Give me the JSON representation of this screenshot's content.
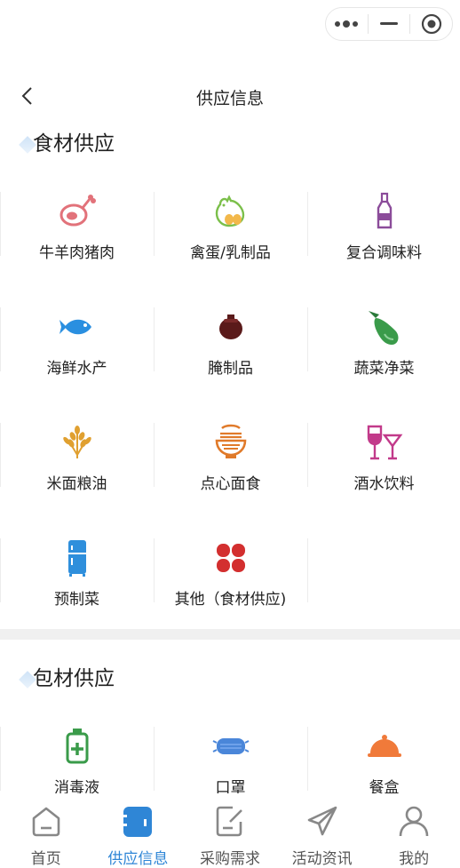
{
  "header": {
    "title": "供应信息"
  },
  "sections": [
    {
      "title": "食材供应",
      "items": [
        {
          "label": "牛羊肉猪肉",
          "icon": "ham-icon"
        },
        {
          "label": "禽蛋/乳制品",
          "icon": "chicken-egg-icon"
        },
        {
          "label": "复合调味料",
          "icon": "sauce-bottle-icon"
        },
        {
          "label": "海鲜水产",
          "icon": "fish-icon"
        },
        {
          "label": "腌制品",
          "icon": "pickle-jar-icon"
        },
        {
          "label": "蔬菜净菜",
          "icon": "eggplant-icon"
        },
        {
          "label": "米面粮油",
          "icon": "wheat-icon"
        },
        {
          "label": "点心面食",
          "icon": "noodle-bowl-icon"
        },
        {
          "label": "酒水饮料",
          "icon": "wine-glass-icon"
        },
        {
          "label": "预制菜",
          "icon": "fridge-icon"
        },
        {
          "label": "其他（食材供应)",
          "icon": "clover-icon"
        }
      ]
    },
    {
      "title": "包材供应",
      "items": [
        {
          "label": "消毒液",
          "icon": "disinfectant-icon"
        },
        {
          "label": "口罩",
          "icon": "mask-icon"
        },
        {
          "label": "餐盒",
          "icon": "food-cloche-icon"
        }
      ]
    }
  ],
  "tabbar": [
    {
      "label": "首页",
      "icon": "home-icon",
      "active": false
    },
    {
      "label": "供应信息",
      "icon": "supply-icon",
      "active": true
    },
    {
      "label": "采购需求",
      "icon": "purchase-edit-icon",
      "active": false
    },
    {
      "label": "活动资讯",
      "icon": "paper-plane-icon",
      "active": false
    },
    {
      "label": "我的",
      "icon": "user-icon",
      "active": false
    }
  ],
  "colors": {
    "accent": "#2f86d6",
    "meat": "#e2727a",
    "egg": "#7bbf4a",
    "purple": "#8b4c9a",
    "fish": "#2a8fe0",
    "jar": "#5a1a1a",
    "veg": "#3a9b4a",
    "wheat": "#e0a030",
    "noodle": "#e07a2a",
    "wine": "#c23a8a",
    "fridge": "#2f8fdc",
    "clover": "#d32f2f"
  }
}
